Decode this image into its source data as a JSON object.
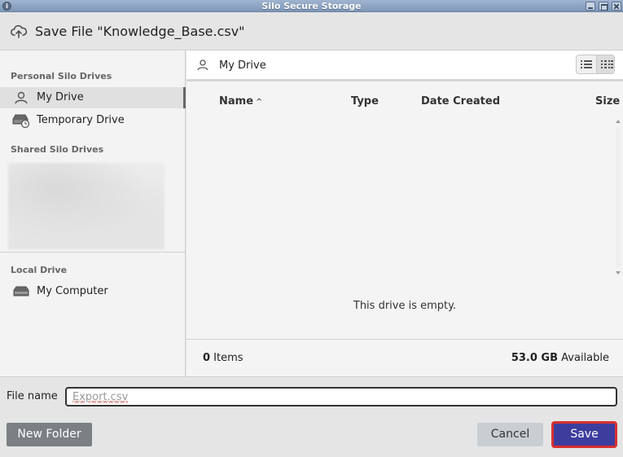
{
  "window": {
    "title": "Silo Secure Storage",
    "app_icon_glyph": "i"
  },
  "dialog": {
    "title": "Save File \"Knowledge_Base.csv\"",
    "icon": "cloud-upload-icon"
  },
  "sidebar": {
    "personal_label": "Personal Silo Drives",
    "items_personal": [
      {
        "label": "My Drive",
        "icon": "person-icon",
        "active": true
      },
      {
        "label": "Temporary Drive",
        "icon": "temporary-drive-icon",
        "active": false
      }
    ],
    "shared_label": "Shared Silo Drives",
    "local_label": "Local Drive",
    "items_local": [
      {
        "label": "My Computer",
        "icon": "hard-drive-icon"
      }
    ]
  },
  "main": {
    "path_label": "My Drive",
    "columns": {
      "name": "Name",
      "sort_indicator": "^",
      "type": "Type",
      "date": "Date Created",
      "size": "Size"
    },
    "empty_message": "This drive is empty.",
    "footer": {
      "count": "0",
      "count_label": " Items",
      "available": "53.0 GB",
      "available_label": " Available"
    }
  },
  "filename": {
    "label": "File name",
    "placeholder": "Export.csv"
  },
  "buttons": {
    "new_folder": "New Folder",
    "cancel": "Cancel",
    "save": "Save"
  },
  "colors": {
    "save_bg": "#3d3d9e",
    "save_border": "#d9312f",
    "titlebar": "#8fa6c4"
  }
}
